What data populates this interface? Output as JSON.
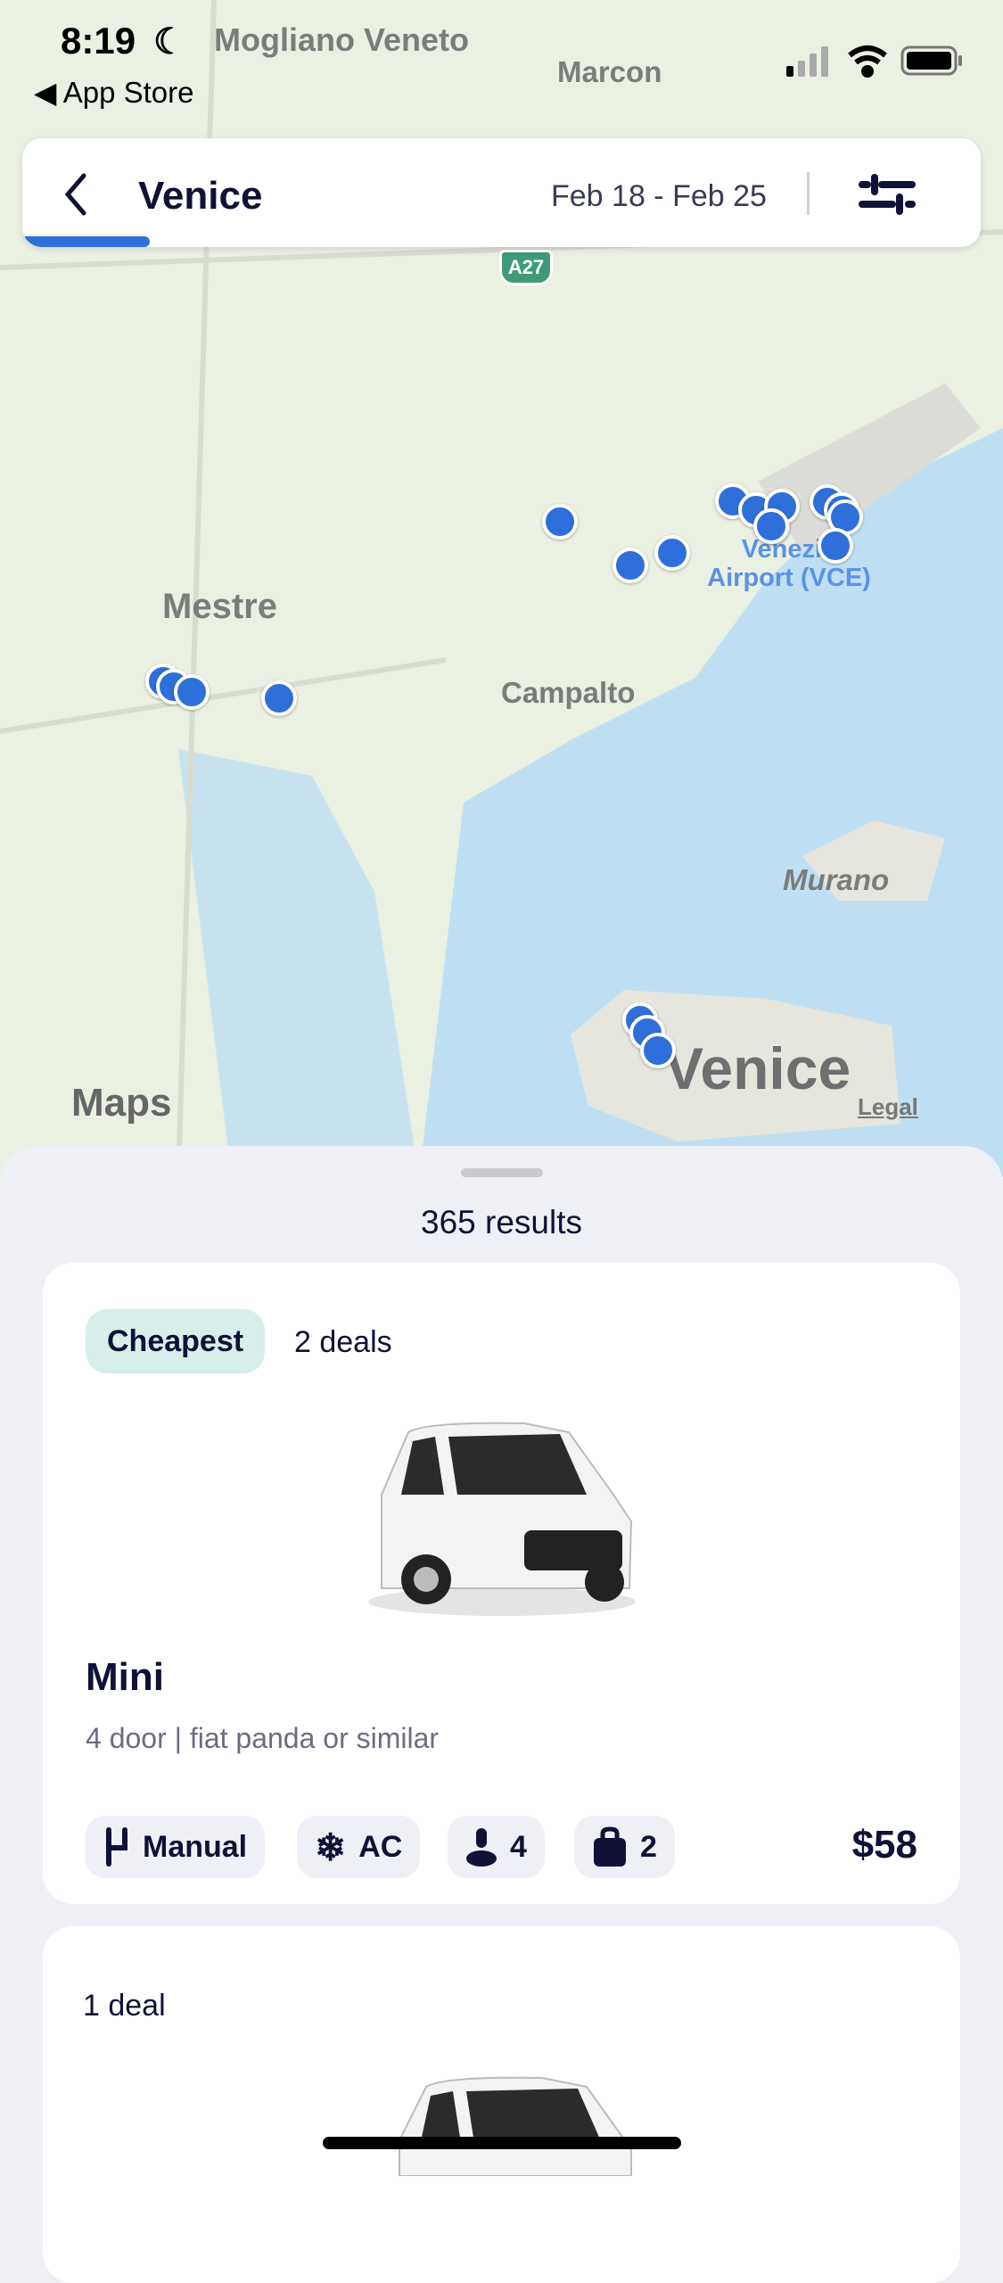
{
  "status_bar": {
    "time": "8:19",
    "back_app": "App Store"
  },
  "map": {
    "labels": {
      "mogliano": "Mogliano Veneto",
      "marcon": "Marcon",
      "mestre": "Mestre",
      "campalto": "Campalto",
      "airport": "Venezia Airport (VCE)",
      "murano": "Murano",
      "venice": "Venice",
      "highway": "A27"
    },
    "attribution": "Maps",
    "legal": "Legal",
    "marker_color": "#2f6fd9"
  },
  "header": {
    "title": "Venice",
    "dates": "Feb 18 - Feb 25",
    "back_icon": "chevron-left-icon",
    "filter_icon": "sliders-icon",
    "progress_percent": 10
  },
  "results": {
    "count_label": "365 results"
  },
  "cards": [
    {
      "badge": "Cheapest",
      "deals": "2 deals",
      "category": "Mini",
      "description": "4 door | fiat panda or similar",
      "features": {
        "transmission": "Manual",
        "ac": "AC",
        "seats": "4",
        "bags": "2"
      },
      "price": "$58"
    },
    {
      "deals": "1 deal"
    }
  ],
  "colors": {
    "accent": "#2f6fd9",
    "badge_bg": "#d7eeea",
    "text": "#0f1136",
    "water": "#bfe0f2"
  }
}
